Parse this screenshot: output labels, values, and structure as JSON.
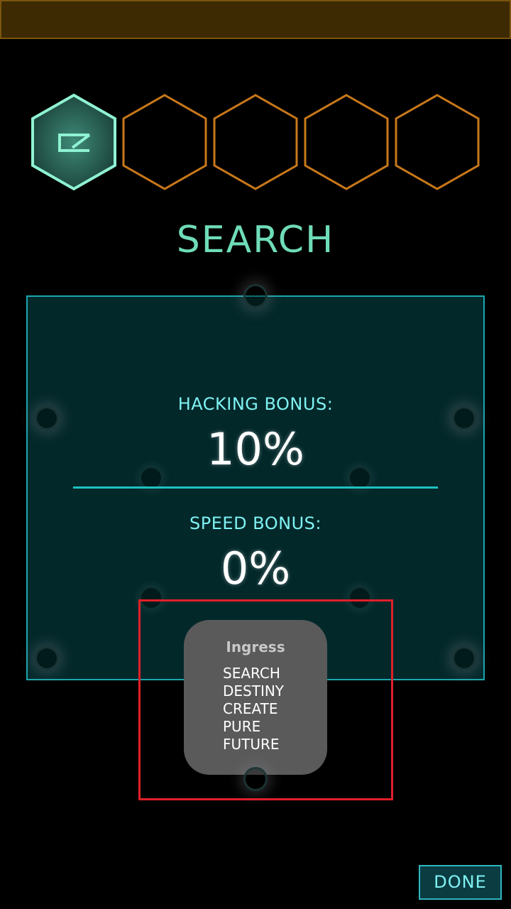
{
  "header": {
    "bar_color": "#3d2a03"
  },
  "glyph_sequence": {
    "hexes": [
      {
        "state": "active",
        "glyph": "search-glyph-icon"
      },
      {
        "state": "empty"
      },
      {
        "state": "empty"
      },
      {
        "state": "empty"
      },
      {
        "state": "empty"
      }
    ],
    "active_color": "#6fdcb9",
    "empty_color": "#c8781a"
  },
  "glyph_title": "SEARCH",
  "stats": {
    "hacking_bonus_label": "HACKING BONUS:",
    "hacking_bonus_value": "10%",
    "speed_bonus_label": "SPEED BONUS:",
    "speed_bonus_value": "0%"
  },
  "toast": {
    "title": "Ingress",
    "lines": [
      "SEARCH",
      "DESTINY",
      "CREATE",
      "PURE",
      "FUTURE"
    ]
  },
  "done_label": "DONE",
  "highlight_color": "#e0202a"
}
